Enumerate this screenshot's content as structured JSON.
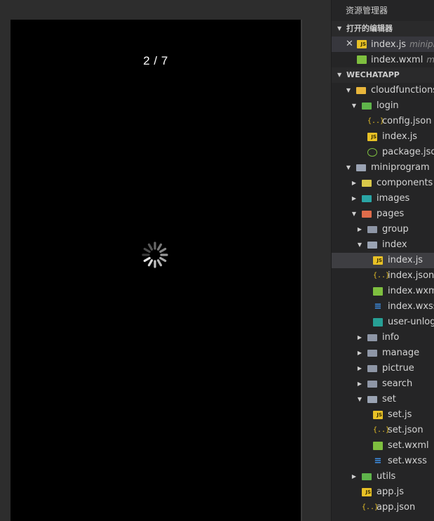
{
  "simulator": {
    "page_counter": "2 / 7",
    "background": "#000000",
    "loading": true
  },
  "explorer": {
    "title": "资源管理器",
    "open_editors": {
      "label": "打开的编辑器",
      "items": [
        {
          "name": "index.js",
          "desc": "miniprog",
          "icon": "js-icon",
          "closable": true,
          "selected": true
        },
        {
          "name": "index.wxml",
          "desc": "mi",
          "icon": "wxml-icon",
          "closable": false,
          "selected": false
        }
      ]
    },
    "workspace": {
      "label": "WECHATAPP",
      "tree": [
        {
          "name": "cloudfunctions",
          "depth": 0,
          "type": "folder-cloud",
          "open": true
        },
        {
          "name": "login",
          "depth": 1,
          "type": "folder-green",
          "open": true
        },
        {
          "name": "config.json",
          "depth": 2,
          "type": "json"
        },
        {
          "name": "index.js",
          "depth": 2,
          "type": "js"
        },
        {
          "name": "package.json",
          "depth": 2,
          "type": "pkg"
        },
        {
          "name": "miniprogram",
          "depth": 0,
          "type": "folder-open",
          "open": true
        },
        {
          "name": "components",
          "depth": 1,
          "type": "folder-yellow",
          "open": false
        },
        {
          "name": "images",
          "depth": 1,
          "type": "folder-teal",
          "open": false
        },
        {
          "name": "pages",
          "depth": 1,
          "type": "folder-red",
          "open": true
        },
        {
          "name": "group",
          "depth": 2,
          "type": "folder",
          "open": false
        },
        {
          "name": "index",
          "depth": 2,
          "type": "folder-open",
          "open": true
        },
        {
          "name": "index.js",
          "depth": 3,
          "type": "js",
          "active": true
        },
        {
          "name": "index.json",
          "depth": 3,
          "type": "json"
        },
        {
          "name": "index.wxml",
          "depth": 3,
          "type": "wxml"
        },
        {
          "name": "index.wxss",
          "depth": 3,
          "type": "wxss"
        },
        {
          "name": "user-unlog",
          "depth": 3,
          "type": "img"
        },
        {
          "name": "info",
          "depth": 2,
          "type": "folder",
          "open": false
        },
        {
          "name": "manage",
          "depth": 2,
          "type": "folder",
          "open": false
        },
        {
          "name": "pictrue",
          "depth": 2,
          "type": "folder",
          "open": false
        },
        {
          "name": "search",
          "depth": 2,
          "type": "folder",
          "open": false
        },
        {
          "name": "set",
          "depth": 2,
          "type": "folder-open",
          "open": true
        },
        {
          "name": "set.js",
          "depth": 3,
          "type": "js"
        },
        {
          "name": "set.json",
          "depth": 3,
          "type": "json"
        },
        {
          "name": "set.wxml",
          "depth": 3,
          "type": "wxml"
        },
        {
          "name": "set.wxss",
          "depth": 3,
          "type": "wxss"
        },
        {
          "name": "utils",
          "depth": 1,
          "type": "folder-green",
          "open": false
        },
        {
          "name": "app.js",
          "depth": 1,
          "type": "js"
        },
        {
          "name": "app.json",
          "depth": 1,
          "type": "json"
        }
      ]
    }
  },
  "colors": {
    "sidebar_bg": "#252526",
    "selected_bg": "#37373d",
    "js": "#e8c126",
    "wxml": "#7ebf3f",
    "wxss": "#3d8fe6"
  }
}
